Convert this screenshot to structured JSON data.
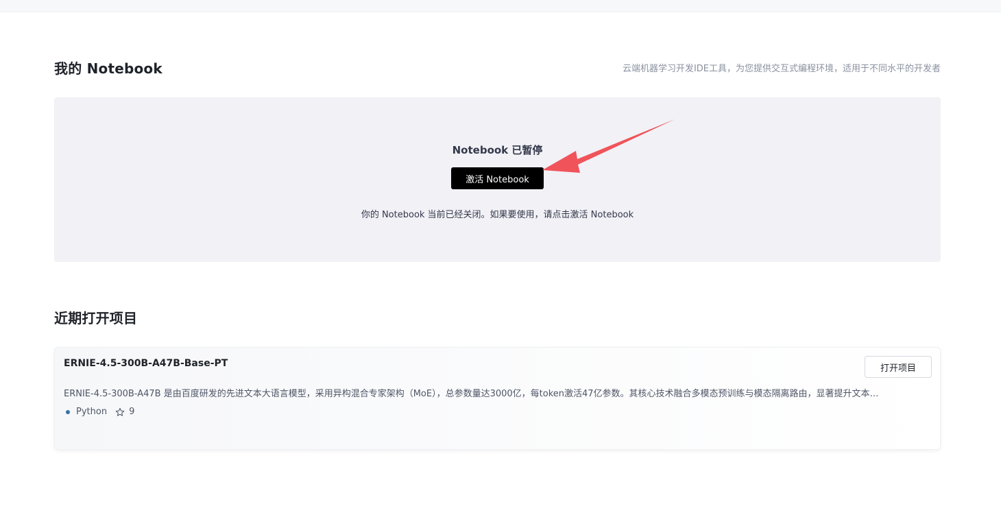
{
  "notebook_section": {
    "title": "我的 Notebook",
    "description": "云端机器学习开发IDE工具，为您提供交互式编程环境，适用于不同水平的开发者"
  },
  "notebook_panel": {
    "status": "Notebook 已暂停",
    "activate_label": "激活 Notebook",
    "hint": "你的 Notebook 当前已经关闭。如果要使用，请点击激活 Notebook",
    "arrow_color": "#f0545a"
  },
  "recent_section": {
    "title": "近期打开项目"
  },
  "projects": [
    {
      "name": "ERNIE-4.5-300B-A47B-Base-PT",
      "description": "ERNIE-4.5-300B-A47B 是由百度研发的先进文本大语言模型，采用异构混合专家架构（MoE），总参数量达3000亿，每token激活47亿参数。其核心技术融合多模态预训练与模态隔离路由，显著提升文本…",
      "language": "Python",
      "stars": "9",
      "open_label": "打开项目"
    }
  ]
}
